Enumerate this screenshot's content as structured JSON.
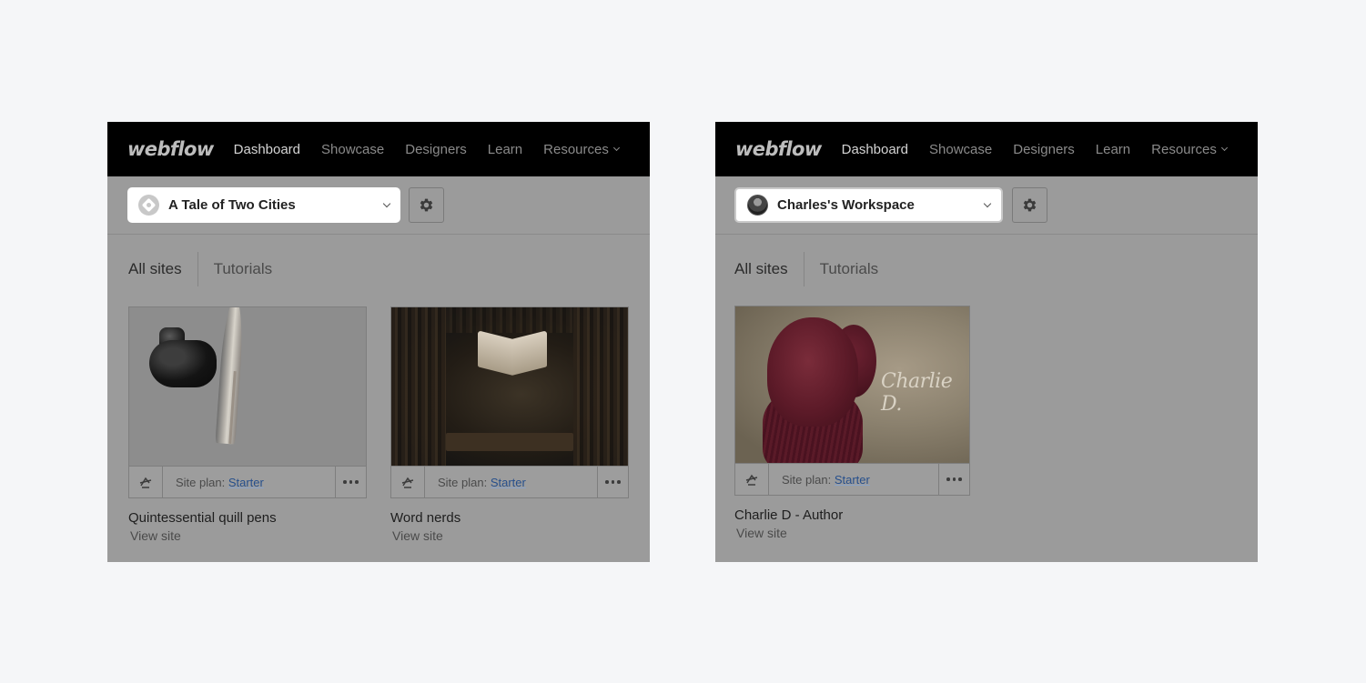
{
  "nav": {
    "logo": "webflow",
    "links": [
      "Dashboard",
      "Showcase",
      "Designers",
      "Learn",
      "Resources"
    ]
  },
  "left": {
    "workspace": {
      "name": "A Tale of Two Cities",
      "icon": "workspace-default-icon"
    },
    "tabs": {
      "all_sites": "All sites",
      "tutorials": "Tutorials"
    },
    "sites": [
      {
        "name": "Quintessential quill pens",
        "plan_label": "Site plan:",
        "plan": "Starter",
        "view": "View site"
      },
      {
        "name": "Word nerds",
        "plan_label": "Site plan:",
        "plan": "Starter",
        "view": "View site"
      }
    ]
  },
  "right": {
    "workspace": {
      "name": "Charles's Workspace",
      "icon": "user-avatar"
    },
    "tabs": {
      "all_sites": "All sites",
      "tutorials": "Tutorials"
    },
    "sites": [
      {
        "name": "Charlie D - Author",
        "plan_label": "Site plan:",
        "plan": "Starter",
        "view": "View site",
        "thumb_text": "Charlie D."
      }
    ]
  },
  "colors": {
    "overlay_gray": "#9b9b9b",
    "nav_bg": "#000000",
    "link_blue": "#264f8c"
  }
}
